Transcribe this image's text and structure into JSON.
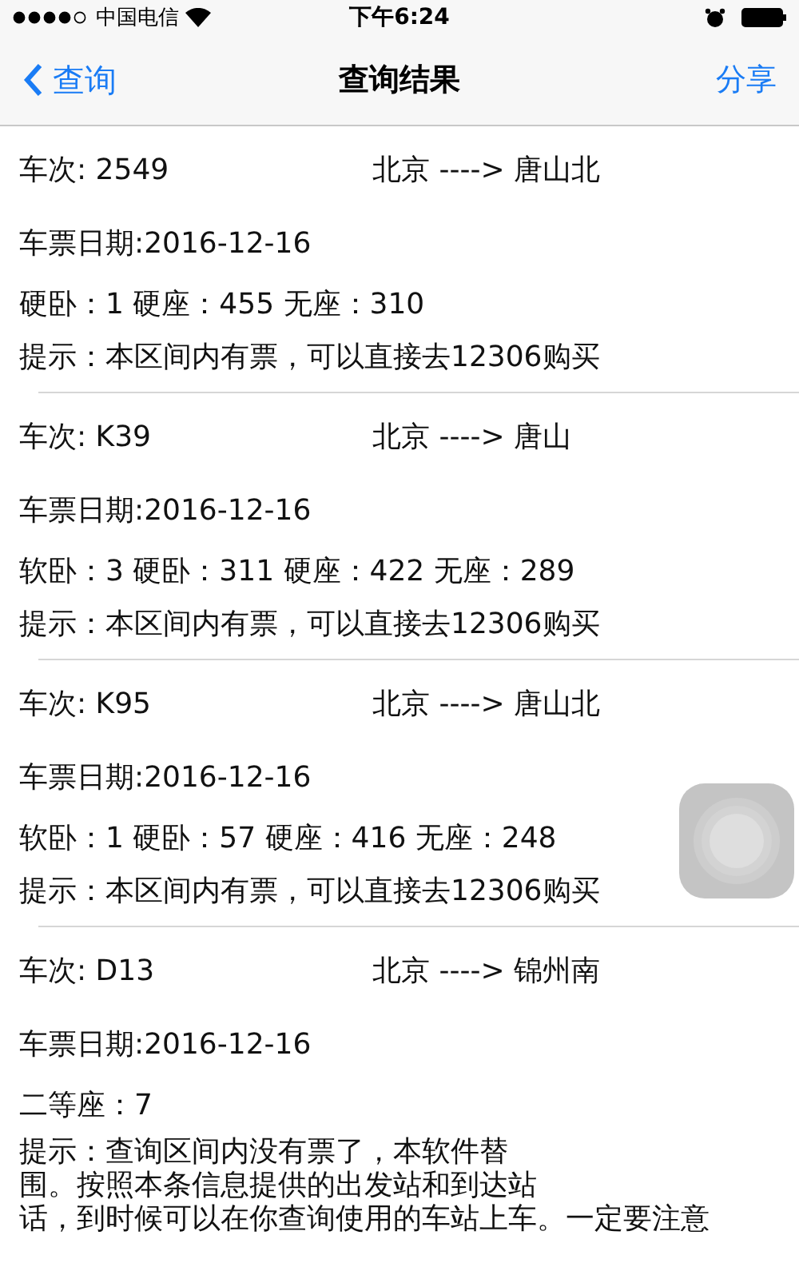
{
  "status_bar": {
    "carrier": "中国电信",
    "time": "下午6:24"
  },
  "nav": {
    "back": "查询",
    "title": "查询结果",
    "action": "分享"
  },
  "records": [
    {
      "train": "车次: 2549",
      "route": "北京 ----> 唐山北",
      "date": "车票日期:2016-12-16",
      "seats": "硬卧：1 硬座：455 无座：310",
      "tip_lines": [
        "提示：本区间内有票，可以直接去12306购买"
      ]
    },
    {
      "train": "车次: K39",
      "route": "北京 ----> 唐山",
      "date": "车票日期:2016-12-16",
      "seats": "软卧：3  硬卧：311  硬座：422 无座：289",
      "tip_lines": [
        "提示：本区间内有票，可以直接去12306购买"
      ]
    },
    {
      "train": "车次: K95",
      "route": "北京 ----> 唐山北",
      "date": "车票日期:2016-12-16",
      "seats": "软卧：1  硬卧：57  硬座：416  无座：248",
      "tip_lines": [
        "提示：本区间内有票，可以直接去12306购买"
      ]
    },
    {
      "train": "车次: D13",
      "route": "北京 ----> 锦州南",
      "date": "车票日期:2016-12-16",
      "seats": "二等座：7",
      "tip_lines": [
        "提示：查询区间内没有票了，本软件替",
        "围。按照本条信息提供的出发站和到达站",
        "话，到时候可以在你查询使用的车站上车。一定要注意"
      ]
    }
  ]
}
